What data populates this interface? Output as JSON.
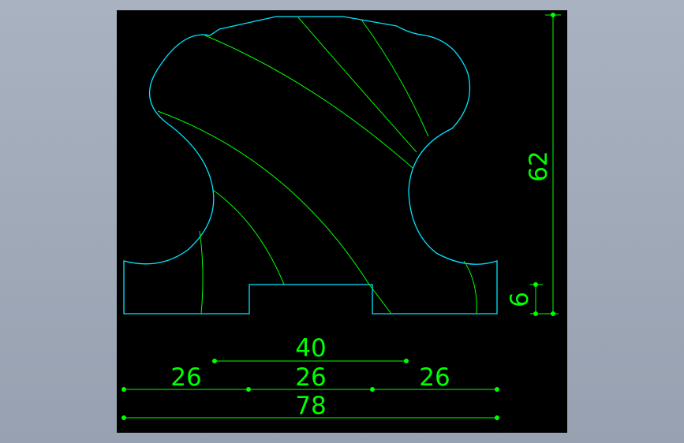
{
  "drawing": {
    "colors": {
      "profile": "#00e5ff",
      "spiral": "#00ff00",
      "dimension": "#00ff00",
      "background": "#000000",
      "frame": "#9aa4b4"
    },
    "dimensions": {
      "d_40": "40",
      "d_26_left": "26",
      "d_26_mid": "26",
      "d_26_right": "26",
      "d_78": "78",
      "d_62": "62",
      "d_6": "6"
    }
  }
}
